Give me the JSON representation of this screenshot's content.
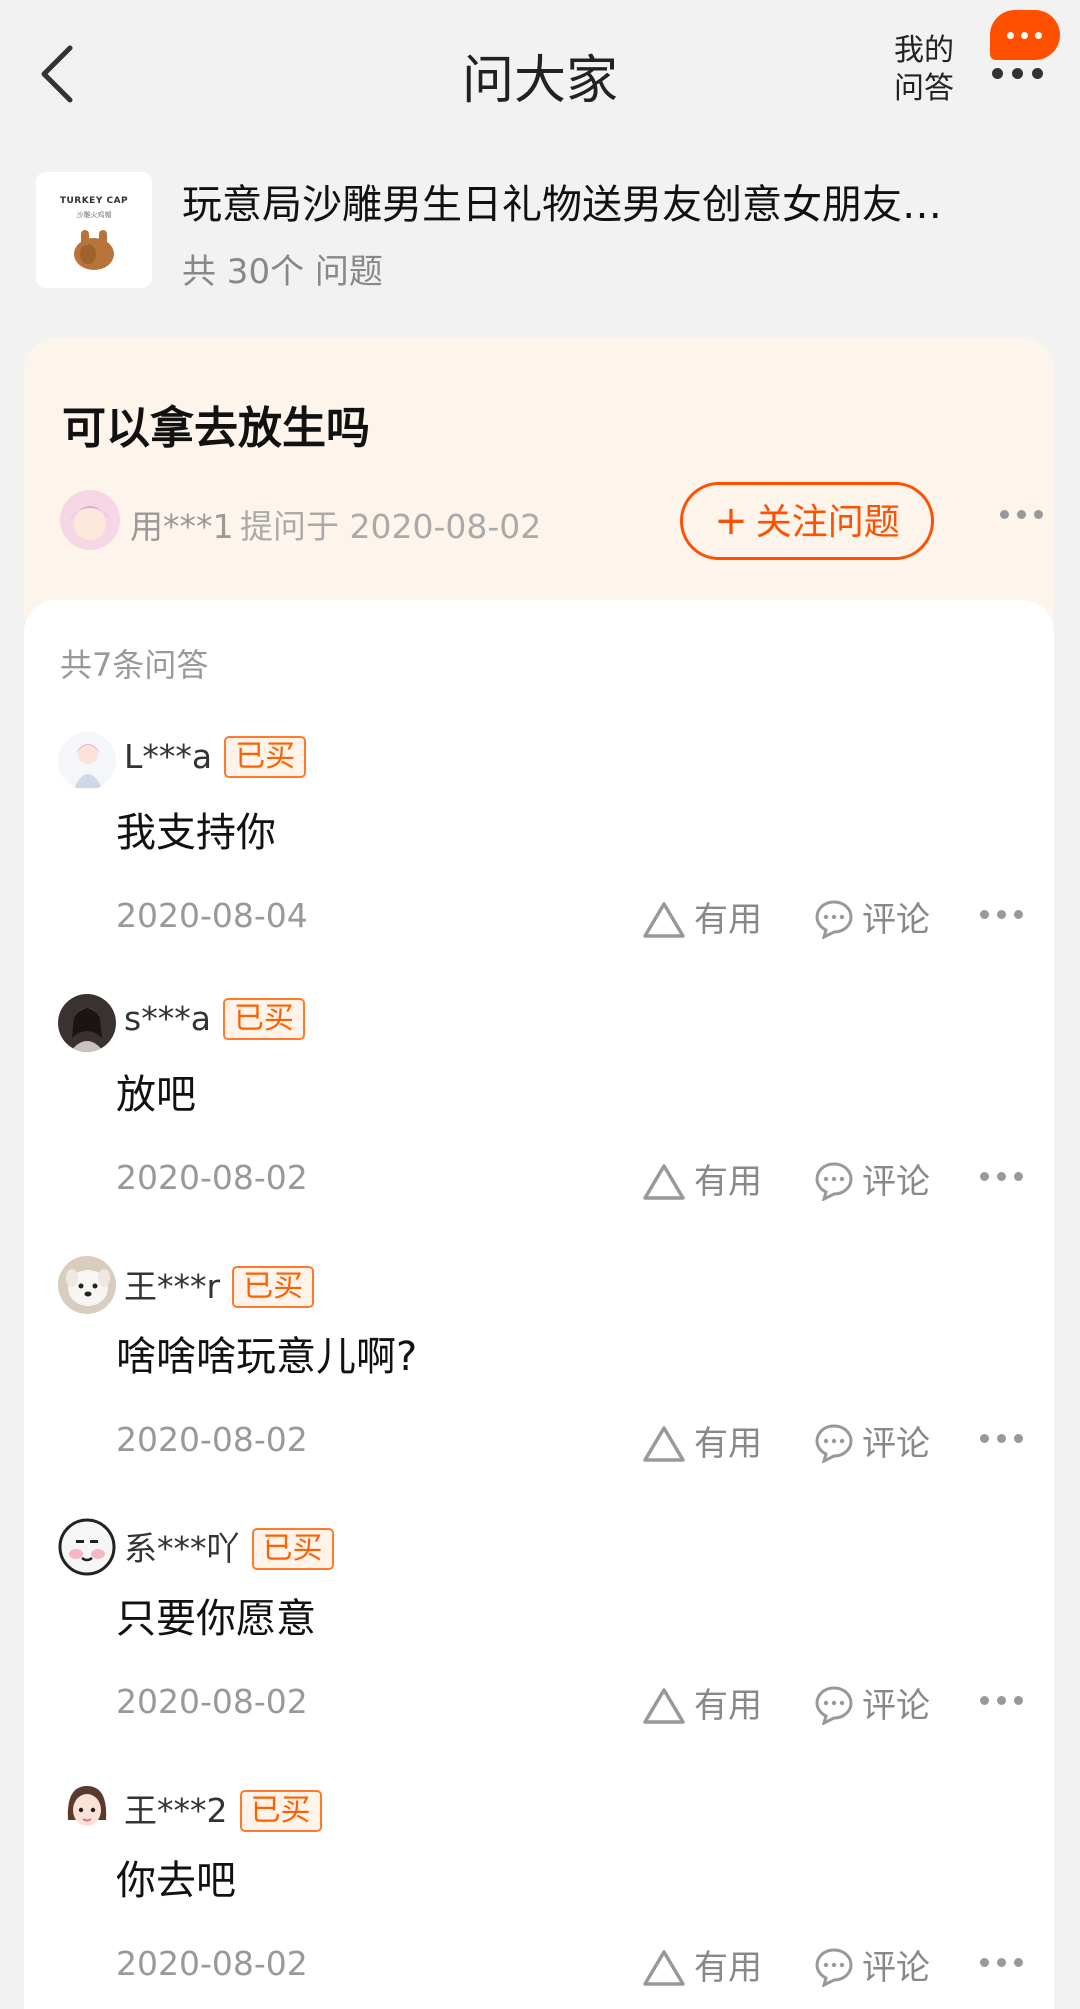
{
  "header": {
    "title": "问大家",
    "my_qa_line1": "我的",
    "my_qa_line2": "问答",
    "accent_color": "#ff5000"
  },
  "product": {
    "title": "玩意局沙雕男生日礼物送男友创意女朋友…",
    "question_count": "共 30个 问题",
    "thumbnail_brand": "TURKEY CAP",
    "thumbnail_sub": "沙雕火鸡帽"
  },
  "question": {
    "text": "可以拿去放生吗",
    "asker": "用***1",
    "asked_time": "提问于 2020-08-02",
    "follow_label": "关注问题"
  },
  "answers_section": {
    "count_label": "共7条问答",
    "useful_label": "有用",
    "comment_label": "评论",
    "bought_label": "已买",
    "items": [
      {
        "user": "L***a",
        "text": "我支持你",
        "date": "2020-08-04",
        "avatar": "anime-girl-avatar"
      },
      {
        "user": "s***a",
        "text": "放吧",
        "date": "2020-08-02",
        "avatar": "photo-avatar"
      },
      {
        "user": "王***r",
        "text": "啥啥啥玩意儿啊?",
        "date": "2020-08-02",
        "avatar": "dog-avatar"
      },
      {
        "user": "系***吖",
        "text": "只要你愿意",
        "date": "2020-08-02",
        "avatar": "meme-face-avatar"
      },
      {
        "user": "王***2",
        "text": "你去吧",
        "date": "2020-08-02",
        "avatar": "girl-avatar"
      }
    ]
  }
}
